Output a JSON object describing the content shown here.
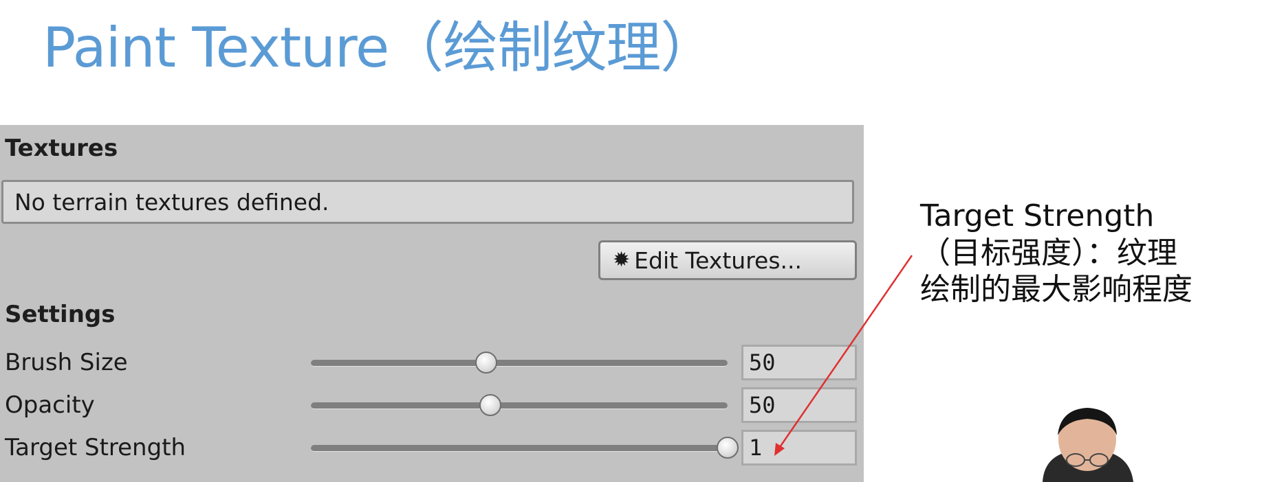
{
  "slide": {
    "title": "Paint Texture（绘制纹理）"
  },
  "panel": {
    "textures_header": "Textures",
    "help_text": "No terrain textures defined.",
    "edit_button": {
      "label": "Edit Textures...",
      "icon": "gear-icon"
    },
    "settings_header": "Settings",
    "settings": [
      {
        "label": "Brush Size",
        "value": "50",
        "fraction": 0.42
      },
      {
        "label": "Opacity",
        "value": "50",
        "fraction": 0.43
      },
      {
        "label": "Target Strength",
        "value": "1",
        "fraction": 1.0
      }
    ]
  },
  "annotation": {
    "line1": "Target Strength",
    "line2": "（目标强度）：纹理",
    "line3": "绘制的最大影响程度",
    "arrow_color": "#e03030"
  }
}
